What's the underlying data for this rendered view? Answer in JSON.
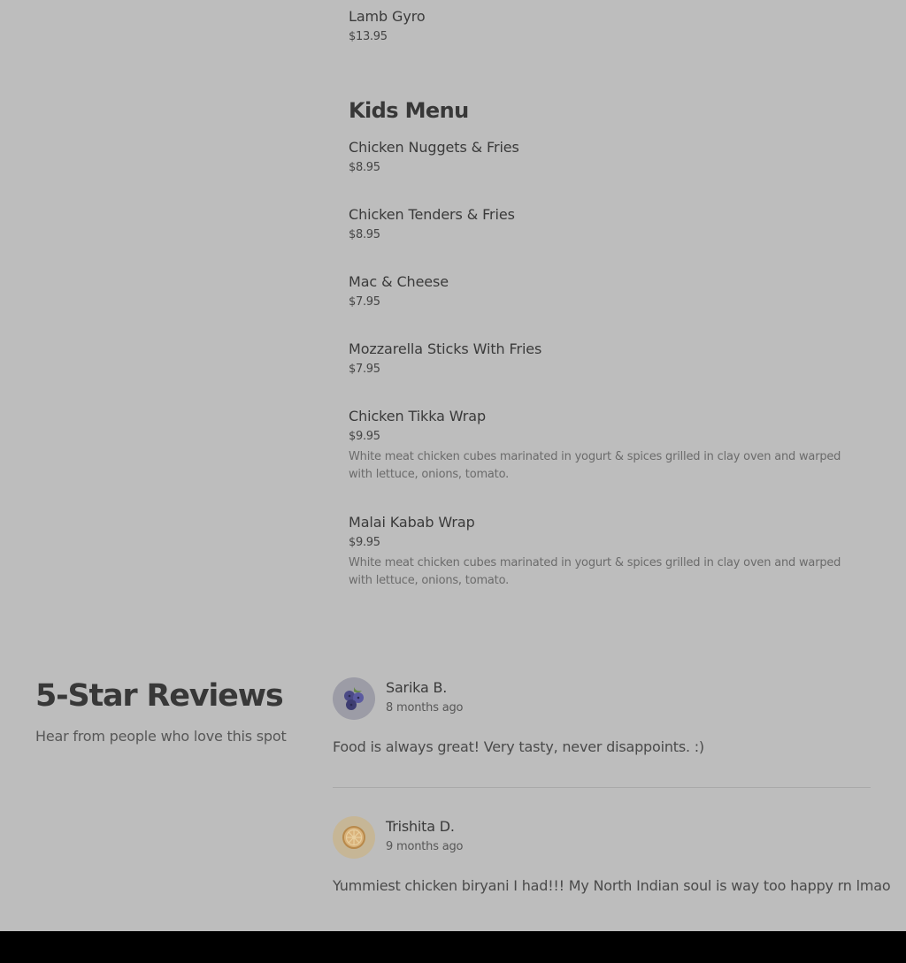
{
  "menu": {
    "top_items": [
      {
        "name": "Lamb Gyro",
        "price": "$13.95"
      }
    ],
    "kids_menu": {
      "title": "Kids Menu",
      "items": [
        {
          "name": "Chicken Nuggets & Fries",
          "price": "$8.95"
        },
        {
          "name": "Chicken Tenders & Fries",
          "price": "$8.95"
        },
        {
          "name": "Mac & Cheese",
          "price": "$7.95"
        },
        {
          "name": "Mozzarella Sticks With Fries",
          "price": "$7.95"
        },
        {
          "name": "Chicken Tikka Wrap",
          "price": "$9.95",
          "description": "White meat chicken cubes marinated in yogurt & spices grilled in clay oven and warped with lettuce, onions, tomato."
        },
        {
          "name": "Malai Kabab Wrap",
          "price": "$9.95",
          "description": "White meat chicken cubes marinated in yogurt & spices grilled in clay oven and warped with lettuce, onions, tomato."
        }
      ]
    }
  },
  "reviews": {
    "heading": "5-Star Reviews",
    "subheading": "Hear from people who love this spot",
    "items": [
      {
        "name": "Sarika B.",
        "date": "8 months ago",
        "text": "Food is always great! Very tasty, never disappoints. :)",
        "avatar_icon": "blueberries-icon"
      },
      {
        "name": "Trishita D.",
        "date": "9 months ago",
        "text": "Yummiest chicken biryani I had!!! My North Indian soul is way too happy rn lmao",
        "avatar_icon": "orange-slice-icon"
      }
    ]
  }
}
